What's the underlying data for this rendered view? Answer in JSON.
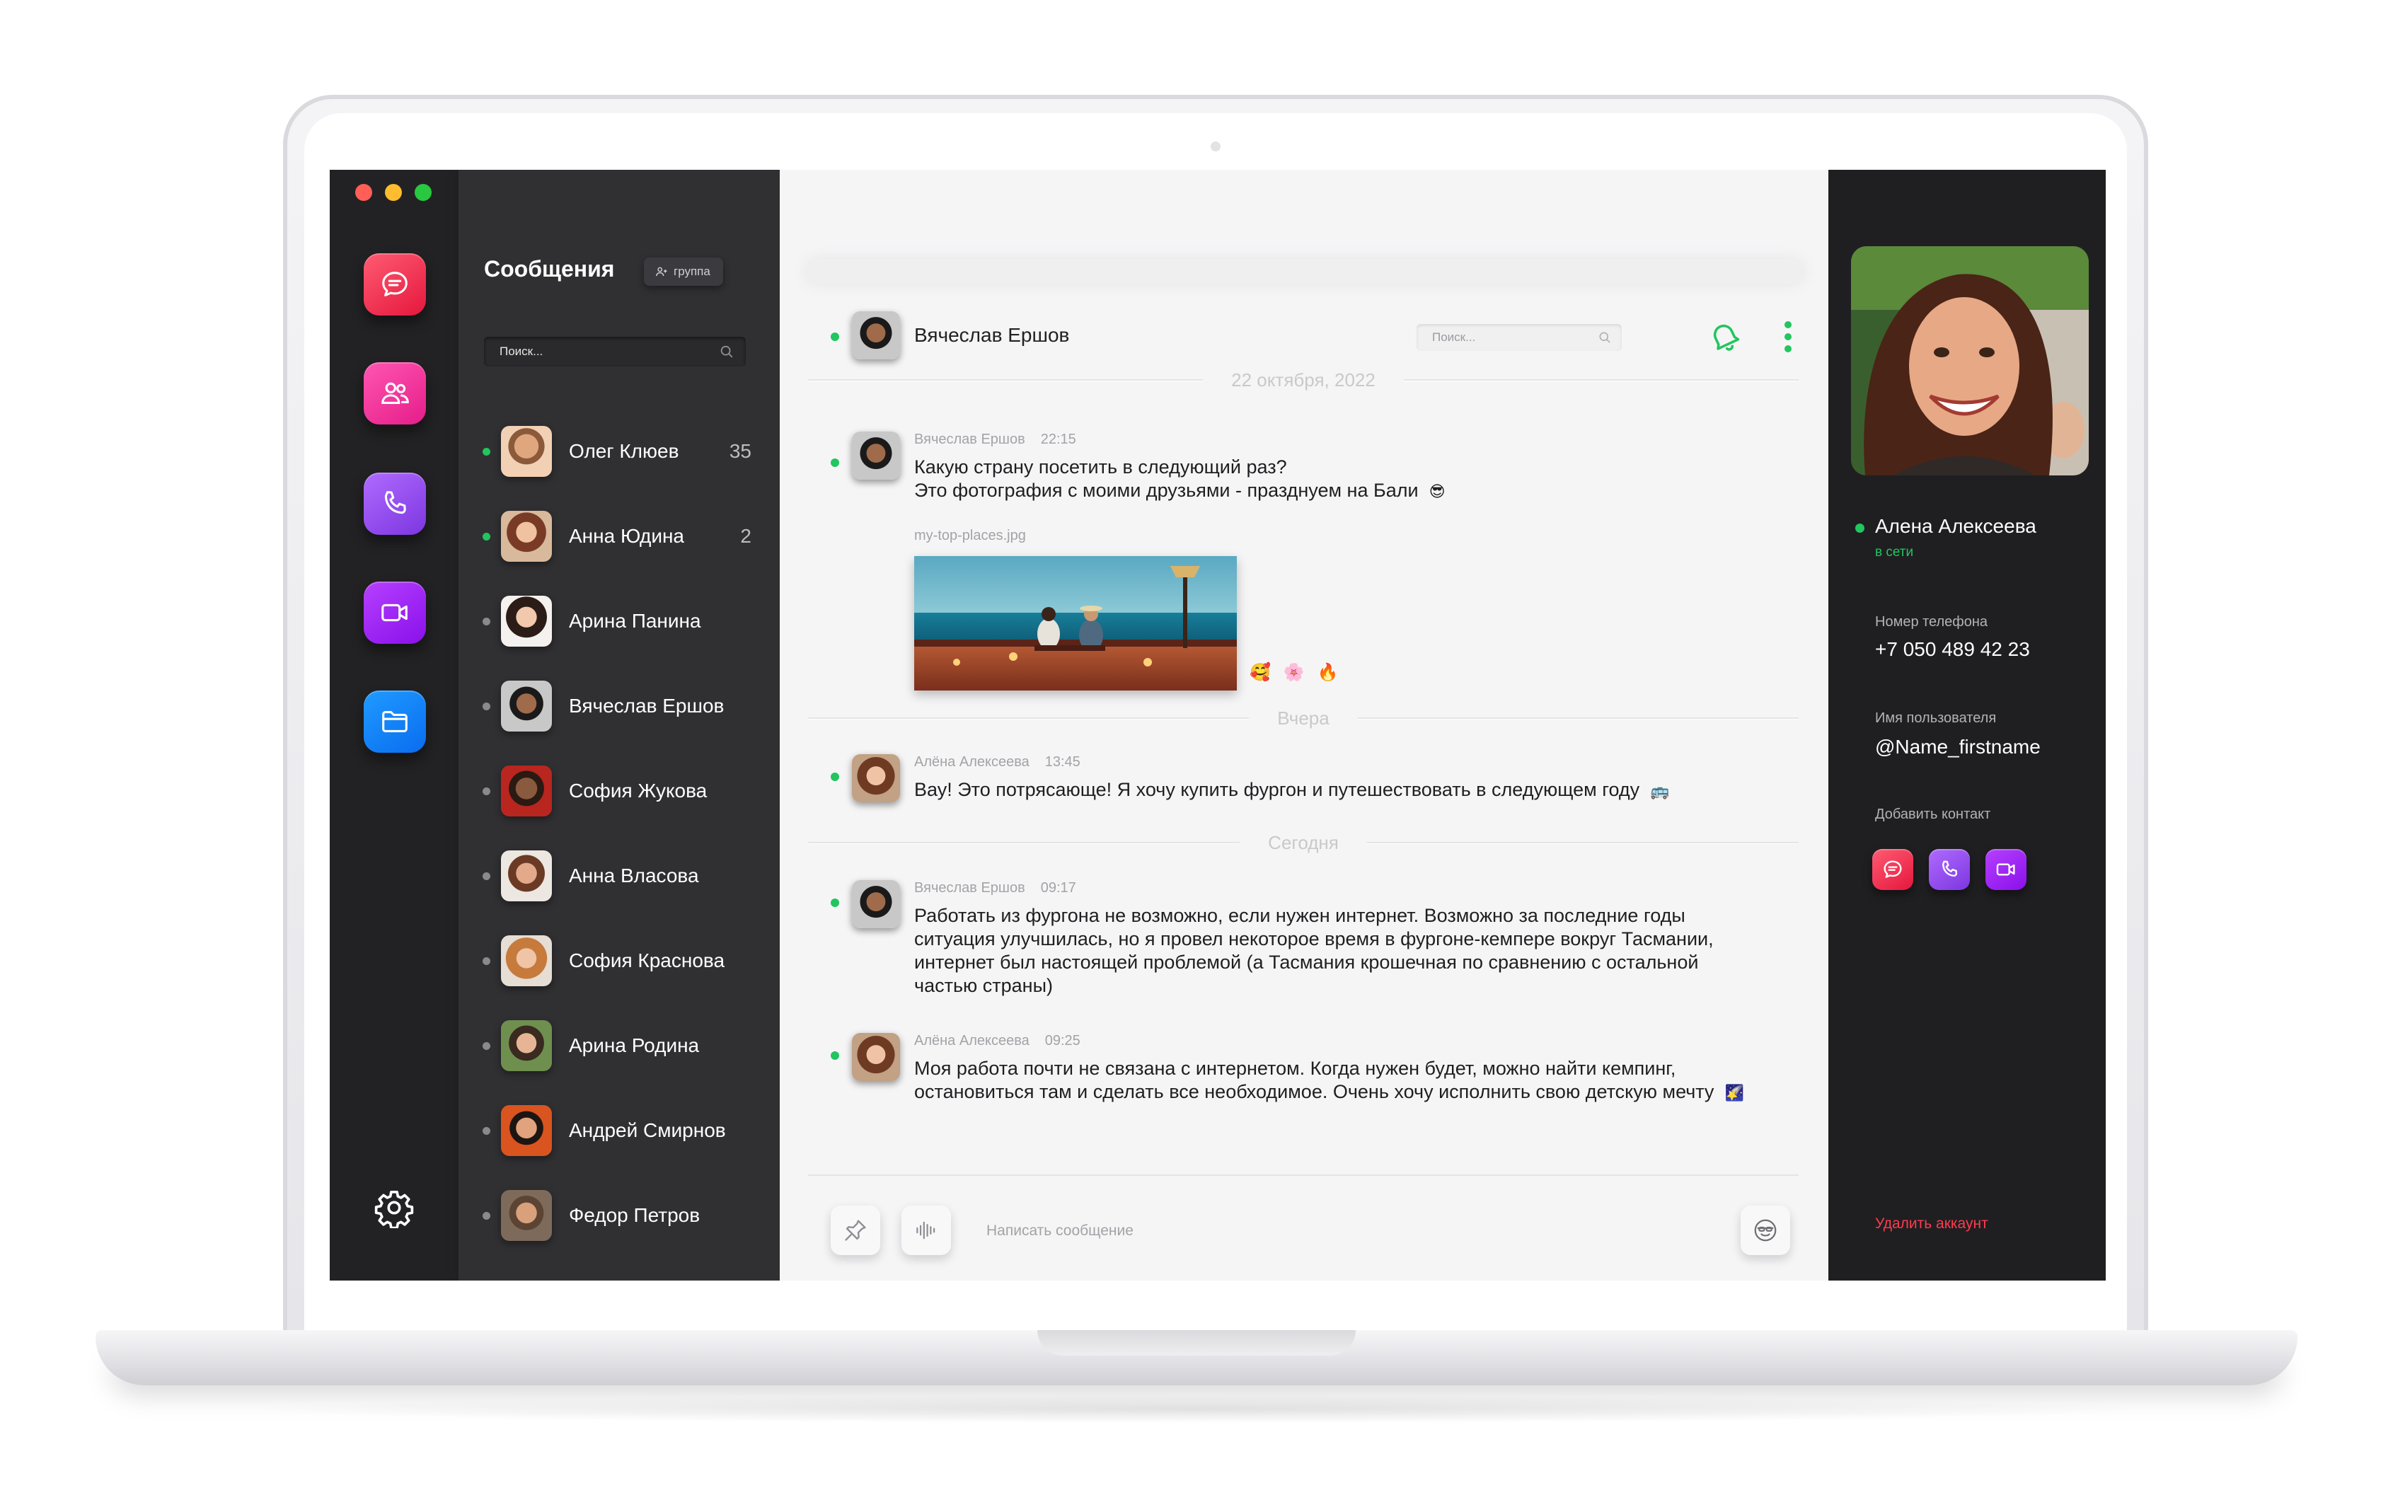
{
  "window": {
    "controls": [
      "close",
      "minimize",
      "maximize"
    ]
  },
  "rail": {
    "items": [
      {
        "icon": "chat-icon",
        "color": "#e5173d"
      },
      {
        "icon": "people-icon",
        "color": "#e51d8a"
      },
      {
        "icon": "phone-icon",
        "color": "#7c36e0"
      },
      {
        "icon": "video-icon",
        "color": "#8a10ea"
      },
      {
        "icon": "folder-icon",
        "color": "#0a6cf0"
      }
    ],
    "settings_icon": "gear-icon"
  },
  "contacts": {
    "title": "Сообщения",
    "group_button": "группа",
    "search_placeholder": "Поиск...",
    "items": [
      {
        "name": "Олег Клюев",
        "count": "35",
        "online": true
      },
      {
        "name": "Анна Юдина",
        "count": "2",
        "online": true
      },
      {
        "name": "Арина Панина",
        "count": "",
        "online": false
      },
      {
        "name": "Вячеслав Ершов",
        "count": "",
        "online": false
      },
      {
        "name": "София Жукова",
        "count": "",
        "online": false
      },
      {
        "name": "Анна Власова",
        "count": "",
        "online": false
      },
      {
        "name": "София Краснова",
        "count": "",
        "online": false
      },
      {
        "name": "Арина Родина",
        "count": "",
        "online": false
      },
      {
        "name": "Андрей Смирнов",
        "count": "",
        "online": false
      },
      {
        "name": "Федор Петров",
        "count": "",
        "online": false
      }
    ]
  },
  "chat": {
    "header": {
      "name": "Вячеслав Ершов",
      "search_placeholder": "Поиск..."
    },
    "dividers": {
      "first": "22 октября, 2022",
      "yesterday": "Вчера",
      "today": "Сегодня"
    },
    "messages": [
      {
        "author": "Вячеслав Ершов",
        "time": "22:15",
        "line1": "Какую страну посетить в следующий раз?",
        "line2": "Это фотография с моими друзьями - празднуем на Бали",
        "emoji": "😎",
        "attachment": "my-top-places.jpg",
        "reactions": [
          "🥰",
          "🌸",
          "🔥"
        ]
      },
      {
        "author": "Алёна Алексеева",
        "time": "13:45",
        "text": "Вау! Это потрясающе! Я хочу купить фургон и путешествовать в следующем году",
        "emoji": "🚌"
      },
      {
        "author": "Вячеслав Ершов",
        "time": "09:17",
        "text": "Работать из фургона не возможно, если нужен интернет. Возможно за последние годы ситуация улучшилась, но я провел некоторое время в фургоне-кемпере вокруг Тасмании, интернет был настоящей проблемой (а Тасмания крошечная по сравнению с остальной частью страны)"
      },
      {
        "author": "Алёна Алексеева",
        "time": "09:25",
        "text": "Моя работа почти не связана с интернетом. Когда нужен будет, можно найти кемпинг, остановиться там и сделать все необходимое. Очень хочу исполнить свою детскую мечту",
        "emoji": "🌠"
      }
    ],
    "composer_placeholder": "Написать сообщение"
  },
  "profile": {
    "name": "Алена Алексеева",
    "status": "в сети",
    "phone_label": "Номер телефона",
    "phone": "+7 050 489 42 23",
    "username_label": "Имя пользователя",
    "username": "@Name_firstname",
    "add_contact_label": "Добавить контакт",
    "delete_account": "Удалить аккаунт"
  },
  "colors": {
    "online": "#22c55e",
    "danger": "#ff3b4f",
    "rail_bg": "#222224",
    "contacts_bg": "#303033",
    "chat_bg": "#f5f5f6",
    "profile_bg": "#1f1f21"
  }
}
